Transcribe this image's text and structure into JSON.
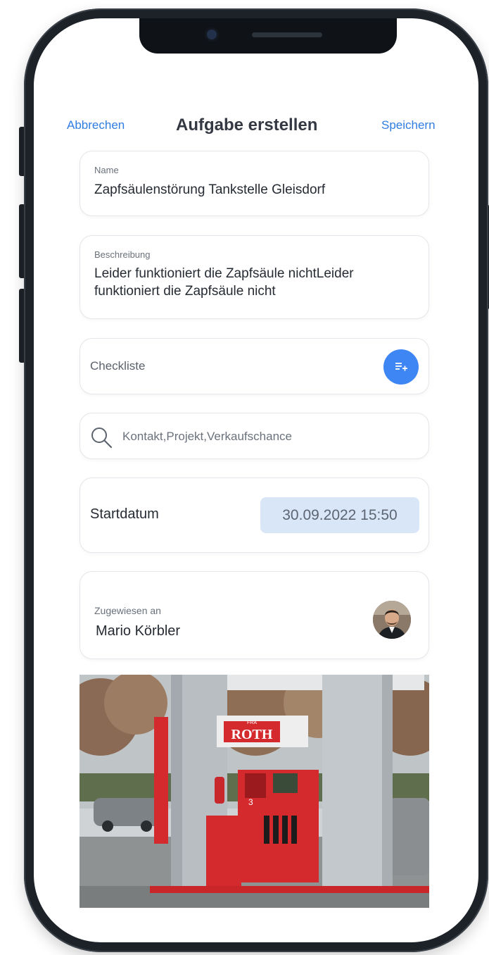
{
  "header": {
    "cancel_label": "Abbrechen",
    "title": "Aufgabe erstellen",
    "save_label": "Speichern"
  },
  "name_field": {
    "label": "Name",
    "value": "Zapfsäulenstörung Tankstelle Gleisdorf"
  },
  "description_field": {
    "label": "Beschreibung",
    "line1": "Leider funktioniert die Zapfsäule nichtLeider",
    "line2": "funktioniert die Zapfsäule nicht"
  },
  "checklist": {
    "label": "Checkliste",
    "add_icon": "playlist-add-icon"
  },
  "search": {
    "placeholder": "Kontakt,Projekt,Verkaufschance",
    "icon": "search-icon"
  },
  "start_date": {
    "label": "Startdatum",
    "value": "30.09.2022 15:50"
  },
  "assignee": {
    "label": "Zugewiesen an",
    "name": "Mario Körbler"
  },
  "photo": {
    "sign_text": "ROTH",
    "sign_prefix": "FRA",
    "pump_number": "3"
  },
  "colors": {
    "accent": "#2f7de1",
    "add_button": "#3f86f5",
    "date_chip": "#d9e6f7",
    "pump_red": "#d42a2e"
  }
}
